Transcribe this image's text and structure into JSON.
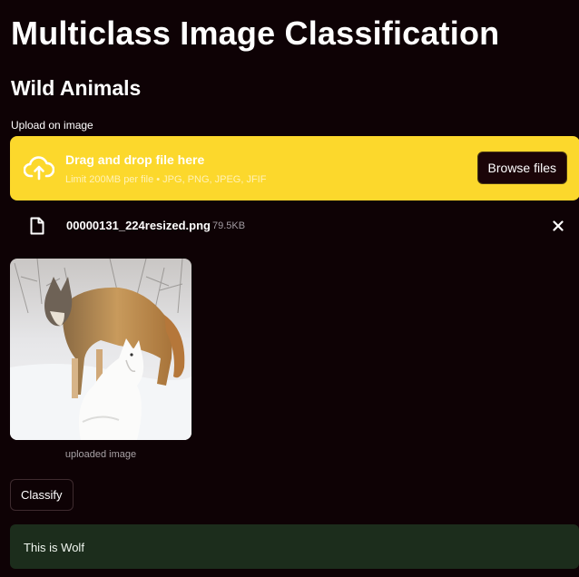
{
  "header": {
    "title": "Multiclass Image Classification",
    "subtitle": "Wild Animals"
  },
  "uploader": {
    "label": "Upload on image",
    "drop_title": "Drag and drop file here",
    "drop_limit": "Limit 200MB per file • JPG, PNG, JPEG, JFIF",
    "browse_label": "Browse files",
    "icon": "cloud-upload-icon"
  },
  "file": {
    "name": "00000131_224resized.png",
    "size": "79.5KB",
    "icon": "file-icon",
    "remove_icon": "close-icon"
  },
  "image": {
    "caption": "uploaded image"
  },
  "actions": {
    "classify_label": "Classify"
  },
  "result": {
    "text": "This is Wolf"
  },
  "colors": {
    "background": "#0e0205",
    "dropzone": "#fcd82c",
    "result_bg": "#1c2d1c"
  }
}
